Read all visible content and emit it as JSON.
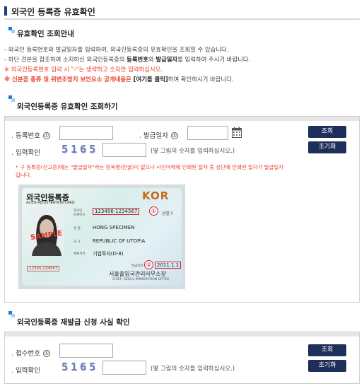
{
  "page": {
    "title": "외국인 등록증 유효확인"
  },
  "guide": {
    "title": "유효확인 조회안내",
    "line1": "- 외국인 등록번호와 발급일자를 입력하여, 외국인등록증의 유효확인을 조회할 수 있습니다.",
    "line2_pre": "- 하단 견본을 참조하여 소지하신 외국인등록증의 ",
    "line2_b1": "등록번호",
    "line2_mid": "와 ",
    "line2_b2": "발급일자",
    "line2_post": "를 입력하여 주시기 바랍니다.",
    "line3": "※ 외국인등록번호 입력 시 \"-\"는 생략하고 숫자만 입력하십시오.",
    "line4_red": "※ 신분증 종류 및 위변조방지 보안요소 공개내용은",
    "line4_bold": " [여기를 클릭]",
    "line4_post": "하여 확인하시기 바랍니다."
  },
  "section1": {
    "title": "외국인등록증 유효확인 조회하기",
    "reg_label": "등록번호",
    "reg_num": "①",
    "issue_label": "발급일자",
    "issue_num": "②",
    "captcha_label": "입력확인",
    "captcha_text": "5165",
    "captcha_hint": "(옆 그림의 숫자를 입력하십시오.)",
    "btn_search": "조회",
    "btn_reset": "초기화",
    "note_line1": "* 구 등록증(신고증)에는 \"발급일자\"라는 항목명(한글)이 없으나 사진아래에 인쇄된 일자 중 상단에 인쇄된 일자가 발급일자",
    "note_line2": "입니다."
  },
  "card": {
    "title": "외국인등록증",
    "subtitle": "ALIEN REGISTRATION CARD",
    "country": "KOR",
    "reg_label_ko": "외국인",
    "reg_label_ko2": "등록번호",
    "reg_number": "123456-1234567",
    "sex": "성별 F",
    "name_label": "성    명",
    "name": "HONG SPECIMEN",
    "country_label": "국    가",
    "country_name": "REPUBLIC OF UTOPIA",
    "status_label": "체류자격",
    "status": "기업투자(D-8)",
    "issue_label": "발급일자",
    "issue_date": "2011.1.1",
    "office": "서울출입국관리사무소장",
    "office_en": "CHIEF, SEOUL IMMIGRATION OFFICE",
    "sample": "SAMPLE",
    "ref": "12345-234567",
    "mark1": "①",
    "mark2": "②"
  },
  "section2": {
    "title": "외국인등록증 재발급 신청 사실 확인",
    "receipt_label": "접수번호",
    "receipt_num": "①",
    "captcha_label": "입력확인",
    "captcha_text": "5165",
    "captcha_hint": "(옆 그림의 숫자를 입력하십시오.)",
    "btn_search": "조회",
    "btn_reset": "초기화"
  }
}
